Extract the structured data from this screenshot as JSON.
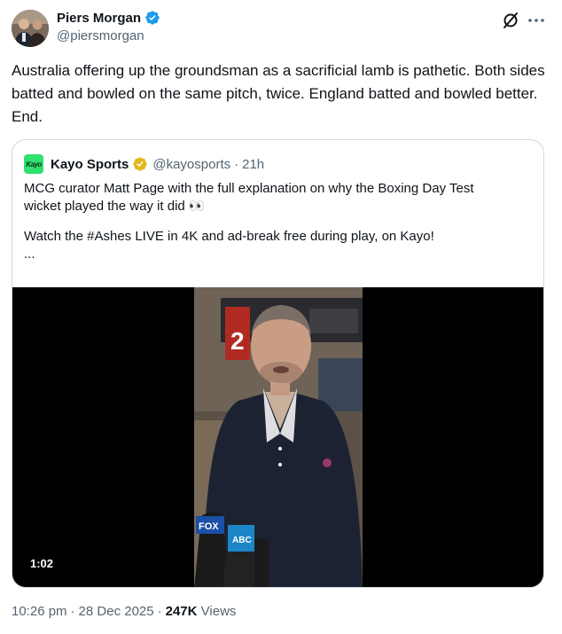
{
  "author": {
    "name": "Piers Morgan",
    "handle": "@piersmorgan",
    "verified_color": "#1d9bf0"
  },
  "tweet": {
    "text": "Australia offering up the groundsman as a sacrificial lamb is pathetic. Both sides batted and bowled on the same pitch, twice. England batted and bowled better. End.",
    "time": "10:26 pm",
    "date": "28 Dec 2025",
    "views_count": "247K",
    "views_label": "Views"
  },
  "quote": {
    "avatar_text": "Kayo",
    "name": "Kayo Sports",
    "handle": "@kayosports",
    "separator": "·",
    "time": "21h",
    "badge_color": "#e2b719",
    "text_lines": [
      "MCG curator Matt Page with the full explanation on why the Boxing Day Test",
      "wicket played the way it did 👀",
      "",
      "Watch the #Ashes LIVE in 4K and ad-break free during play, on Kayo!",
      "..."
    ],
    "video": {
      "duration": "1:02",
      "scoreboard_digit": "2",
      "mic_labels": [
        "FOX",
        "ABC"
      ]
    }
  },
  "icons": {
    "grok": "grok-icon",
    "more": "more-icon",
    "verified": "verified-badge-icon"
  }
}
